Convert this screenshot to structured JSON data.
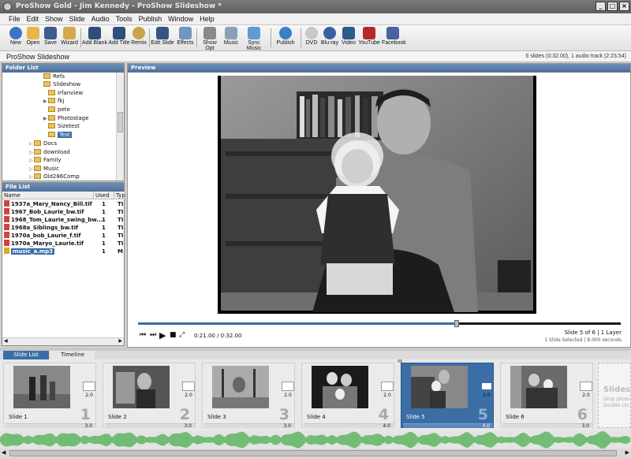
{
  "window": {
    "title": "ProShow Gold - Jim Kennedy - ProShow Slideshow *"
  },
  "menu": [
    "File",
    "Edit",
    "Show",
    "Slide",
    "Audio",
    "Tools",
    "Publish",
    "Window",
    "Help"
  ],
  "toolbar": [
    {
      "label": "New",
      "icon": "new-icon"
    },
    {
      "label": "Open",
      "icon": "open-folder-icon"
    },
    {
      "label": "Save",
      "icon": "save-disk-icon"
    },
    {
      "label": "Wizard",
      "icon": "wizard-icon"
    },
    {
      "label": "Add Blank",
      "icon": "add-blank-icon"
    },
    {
      "label": "Add Title",
      "icon": "add-title-icon"
    },
    {
      "label": "Remix",
      "icon": "remix-icon"
    },
    {
      "label": "Edit Slide",
      "icon": "edit-slide-icon"
    },
    {
      "label": "Effects",
      "icon": "effects-icon"
    },
    {
      "label": "Show Opt",
      "icon": "show-options-icon"
    },
    {
      "label": "Music",
      "icon": "speaker-icon"
    },
    {
      "label": "Sync Music",
      "icon": "sync-music-icon"
    },
    {
      "label": "Publish",
      "icon": "publish-icon"
    },
    {
      "label": "DVD",
      "icon": "dvd-icon"
    },
    {
      "label": "Blu-ray",
      "icon": "bluray-icon"
    },
    {
      "label": "Video",
      "icon": "video-icon"
    },
    {
      "label": "YouTube",
      "icon": "youtube-icon"
    },
    {
      "label": "Facebook",
      "icon": "facebook-icon"
    }
  ],
  "show": {
    "title": "ProShow Slideshow",
    "stats": "6 slides (0:32.00), 1 audio track (2:23.54)"
  },
  "folder_list": {
    "header": "Folder List",
    "items": [
      {
        "label": "Refs"
      },
      {
        "label": "Slideshow"
      },
      {
        "label": "Irfanview"
      },
      {
        "label": "fkj"
      },
      {
        "label": "pete"
      },
      {
        "label": "Photostage"
      },
      {
        "label": "Sizetest"
      },
      {
        "label": "Test",
        "selected": true
      },
      {
        "label": "Docs"
      },
      {
        "label": "download"
      },
      {
        "label": "Family"
      },
      {
        "label": "Music"
      },
      {
        "label": "Old286Comp"
      }
    ]
  },
  "file_list": {
    "header": "File List",
    "columns": [
      "Name",
      "Used",
      "Typ"
    ],
    "rows": [
      {
        "name": "1937a_Mary_Nancy_Bill.tif",
        "used": "1",
        "type": "TI"
      },
      {
        "name": "1967_Bob_Laurie_bw.tif",
        "used": "1",
        "type": "TI"
      },
      {
        "name": "1968_Tom_Laurie_swing_bw....",
        "used": "1",
        "type": "TI"
      },
      {
        "name": "1968a_Siblings_bw.tif",
        "used": "1",
        "type": "TI"
      },
      {
        "name": "1970a_bob_Laurie_f.tif",
        "used": "1",
        "type": "TI"
      },
      {
        "name": "1970a_Maryo_Laurie.tif",
        "used": "1",
        "type": "TI"
      },
      {
        "name": "music_a.mp3",
        "used": "1",
        "type": "M"
      }
    ]
  },
  "preview": {
    "header": "Preview",
    "time": "0:21.00 / 0:32.00",
    "progress": 0.66,
    "slide_info": "Slide 5 of 6  |  1 Layer",
    "selection_info": "1 Slide Selected  |  8.000 seconds"
  },
  "tabs": [
    "Slide List",
    "Timeline"
  ],
  "slides": [
    {
      "label": "Slide 1",
      "num": "1",
      "duration": "3.0",
      "transition": "2.0"
    },
    {
      "label": "Slide 2",
      "num": "2",
      "duration": "3.0",
      "transition": "2.0"
    },
    {
      "label": "Slide 3",
      "num": "3",
      "duration": "3.0",
      "transition": "2.0"
    },
    {
      "label": "Slide 4",
      "num": "4",
      "duration": "4.0",
      "transition": "2.0"
    },
    {
      "label": "Slide 5",
      "num": "5",
      "duration": "4.0",
      "transition": "2.0",
      "selected": true
    },
    {
      "label": "Slide 6",
      "num": "6",
      "duration": "3.0",
      "transition": "2.0"
    }
  ],
  "slides_placeholder": {
    "title": "Slides",
    "line1": "Drop photo",
    "line2": "Double clic"
  },
  "colors": {
    "accent": "#3a6ea5",
    "waveform": "#4caf50",
    "panel_header": "#5b7ca8"
  }
}
